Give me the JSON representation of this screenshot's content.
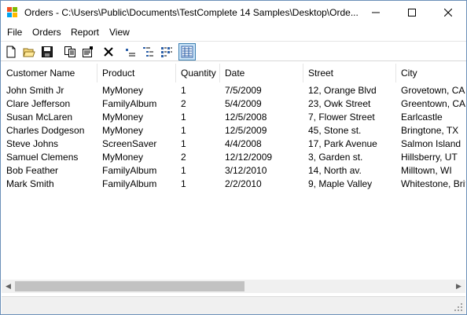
{
  "window": {
    "title": "Orders - C:\\Users\\Public\\Documents\\TestComplete 14 Samples\\Desktop\\Orde..."
  },
  "menu": [
    "File",
    "Orders",
    "Report",
    "View"
  ],
  "toolbar": {
    "buttons": [
      {
        "icon": "new-file-icon"
      },
      {
        "icon": "open-folder-icon"
      },
      {
        "icon": "save-icon"
      },
      {
        "icon": "copy-icon"
      },
      {
        "icon": "properties-icon"
      },
      {
        "icon": "delete-icon"
      },
      {
        "icon": "small-icons-view-icon"
      },
      {
        "icon": "list-view-icon"
      },
      {
        "icon": "tree-view-icon"
      },
      {
        "icon": "details-view-icon",
        "active": true
      }
    ]
  },
  "table": {
    "columns": [
      "Customer Name",
      "Product",
      "Quantity",
      "Date",
      "Street",
      "City"
    ],
    "rows": [
      [
        "John Smith Jr",
        "MyMoney",
        "1",
        "7/5/2009",
        "12, Orange Blvd",
        "Grovetown, CA"
      ],
      [
        "Clare Jefferson",
        "FamilyAlbum",
        "2",
        "5/4/2009",
        "23, Owk Street",
        "Greentown, CA"
      ],
      [
        "Susan McLaren",
        "MyMoney",
        "1",
        "12/5/2008",
        "7, Flower Street",
        "Earlcastle"
      ],
      [
        "Charles Dodgeson",
        "MyMoney",
        "1",
        "12/5/2009",
        "45, Stone st.",
        "Bringtone, TX"
      ],
      [
        "Steve Johns",
        "ScreenSaver",
        "1",
        "4/4/2008",
        "17, Park Avenue",
        "Salmon Island"
      ],
      [
        "Samuel Clemens",
        "MyMoney",
        "2",
        "12/12/2009",
        "3, Garden st.",
        "Hillsberry, UT"
      ],
      [
        "Bob Feather",
        "FamilyAlbum",
        "1",
        "3/12/2010",
        "14, North av.",
        "Milltown, WI"
      ],
      [
        "Mark Smith",
        "FamilyAlbum",
        "1",
        "2/2/2010",
        "9, Maple Valley",
        "Whitestone, Britis"
      ]
    ]
  },
  "colors": {
    "border": "#6b8fb8",
    "toolbar_active_bg": "#cce4f7",
    "scrollbar_bg": "#f0f0f0",
    "scroll_thumb": "#c2c2c2"
  }
}
